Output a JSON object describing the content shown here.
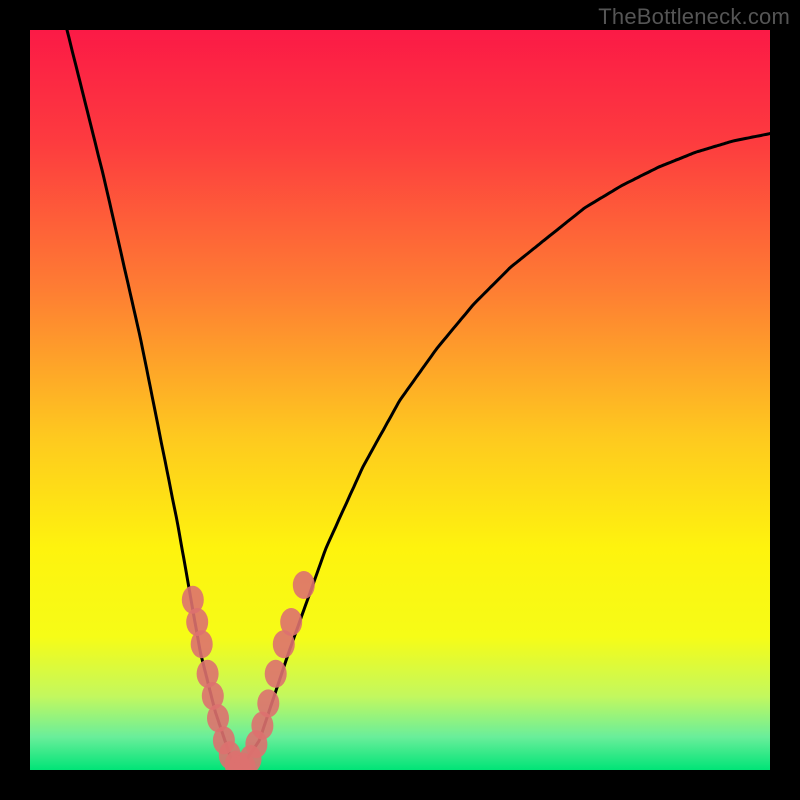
{
  "watermark": "TheBottleneck.com",
  "chart_data": {
    "type": "line",
    "title": "",
    "xlabel": "",
    "ylabel": "",
    "xlim": [
      0,
      100
    ],
    "ylim": [
      0,
      100
    ],
    "grid": false,
    "legend": false,
    "note": "Bottleneck-style V curve over a vertical red→yellow→green gradient. x≈28 is the minimum (y≈0). Series values are estimated curve heights on a 0–100 scale.",
    "series": [
      {
        "name": "bottleneck-curve",
        "x": [
          5,
          10,
          15,
          20,
          23,
          25,
          27,
          28,
          29,
          31,
          33,
          35,
          40,
          45,
          50,
          55,
          60,
          65,
          70,
          75,
          80,
          85,
          90,
          95,
          100
        ],
        "values": [
          100,
          80,
          58,
          33,
          16,
          8,
          2,
          0,
          1,
          4,
          10,
          16,
          30,
          41,
          50,
          57,
          63,
          68,
          72,
          76,
          79,
          81.5,
          83.5,
          85,
          86
        ]
      }
    ],
    "markers": {
      "name": "highlight-dots",
      "color": "#dd716f",
      "points": [
        {
          "x": 22.0,
          "y": 23
        },
        {
          "x": 22.6,
          "y": 20
        },
        {
          "x": 23.2,
          "y": 17
        },
        {
          "x": 24.0,
          "y": 13
        },
        {
          "x": 24.7,
          "y": 10
        },
        {
          "x": 25.4,
          "y": 7
        },
        {
          "x": 26.2,
          "y": 4
        },
        {
          "x": 27.0,
          "y": 2
        },
        {
          "x": 27.8,
          "y": 0.7
        },
        {
          "x": 28.3,
          "y": 0.3
        },
        {
          "x": 29.0,
          "y": 0.4
        },
        {
          "x": 29.8,
          "y": 1.5
        },
        {
          "x": 30.6,
          "y": 3.5
        },
        {
          "x": 31.4,
          "y": 6
        },
        {
          "x": 32.2,
          "y": 9
        },
        {
          "x": 33.2,
          "y": 13
        },
        {
          "x": 34.3,
          "y": 17
        },
        {
          "x": 35.3,
          "y": 20
        },
        {
          "x": 37.0,
          "y": 25
        }
      ]
    },
    "gradient_stops": [
      {
        "offset": 0.0,
        "color": "#fb1a46"
      },
      {
        "offset": 0.15,
        "color": "#fd3b3f"
      },
      {
        "offset": 0.35,
        "color": "#fe7d33"
      },
      {
        "offset": 0.55,
        "color": "#fec91f"
      },
      {
        "offset": 0.7,
        "color": "#fef30e"
      },
      {
        "offset": 0.82,
        "color": "#f6fc17"
      },
      {
        "offset": 0.9,
        "color": "#c3f85e"
      },
      {
        "offset": 0.955,
        "color": "#6aee9a"
      },
      {
        "offset": 1.0,
        "color": "#00e477"
      }
    ]
  }
}
